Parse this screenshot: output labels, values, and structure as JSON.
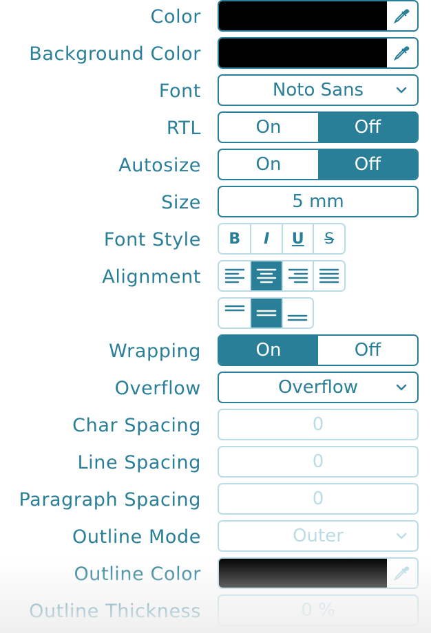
{
  "rows": {
    "color": {
      "label": "Color",
      "swatch": "#000000"
    },
    "background_color": {
      "label": "Background Color",
      "swatch": "#000000"
    },
    "font": {
      "label": "Font",
      "value": "Noto Sans"
    },
    "rtl": {
      "label": "RTL",
      "on": "On",
      "off": "Off",
      "selected": "Off"
    },
    "autosize": {
      "label": "Autosize",
      "on": "On",
      "off": "Off",
      "selected": "Off"
    },
    "size": {
      "label": "Size",
      "value": "5 mm"
    },
    "font_style": {
      "label": "Font Style",
      "buttons": [
        "bold",
        "italic",
        "underline",
        "strikethrough"
      ],
      "glyphs": [
        "B",
        "I",
        "U",
        "S"
      ]
    },
    "alignment": {
      "label": "Alignment",
      "horizontal": [
        "align-left",
        "align-center",
        "align-right",
        "align-justify"
      ],
      "horizontal_selected": "align-center",
      "vertical": [
        "align-top",
        "align-middle",
        "align-bottom"
      ],
      "vertical_selected": "align-middle"
    },
    "wrapping": {
      "label": "Wrapping",
      "on": "On",
      "off": "Off",
      "selected": "On"
    },
    "overflow": {
      "label": "Overflow",
      "value": "Overflow"
    },
    "char_spacing": {
      "label": "Char Spacing",
      "value": "0"
    },
    "line_spacing": {
      "label": "Line Spacing",
      "value": "0"
    },
    "paragraph_spacing": {
      "label": "Paragraph Spacing",
      "value": "0"
    },
    "outline_mode": {
      "label": "Outline Mode",
      "value": "Outer"
    },
    "outline_color": {
      "label": "Outline Color",
      "swatch": "#000000"
    },
    "outline_thickness": {
      "label": "Outline Thickness",
      "value": "0 %"
    }
  },
  "colors": {
    "accent": "#2a7f98",
    "disabled": "#b9dce6"
  },
  "icons": {
    "picker": "eyedropper-icon",
    "chevron": "chevron-down-icon"
  }
}
